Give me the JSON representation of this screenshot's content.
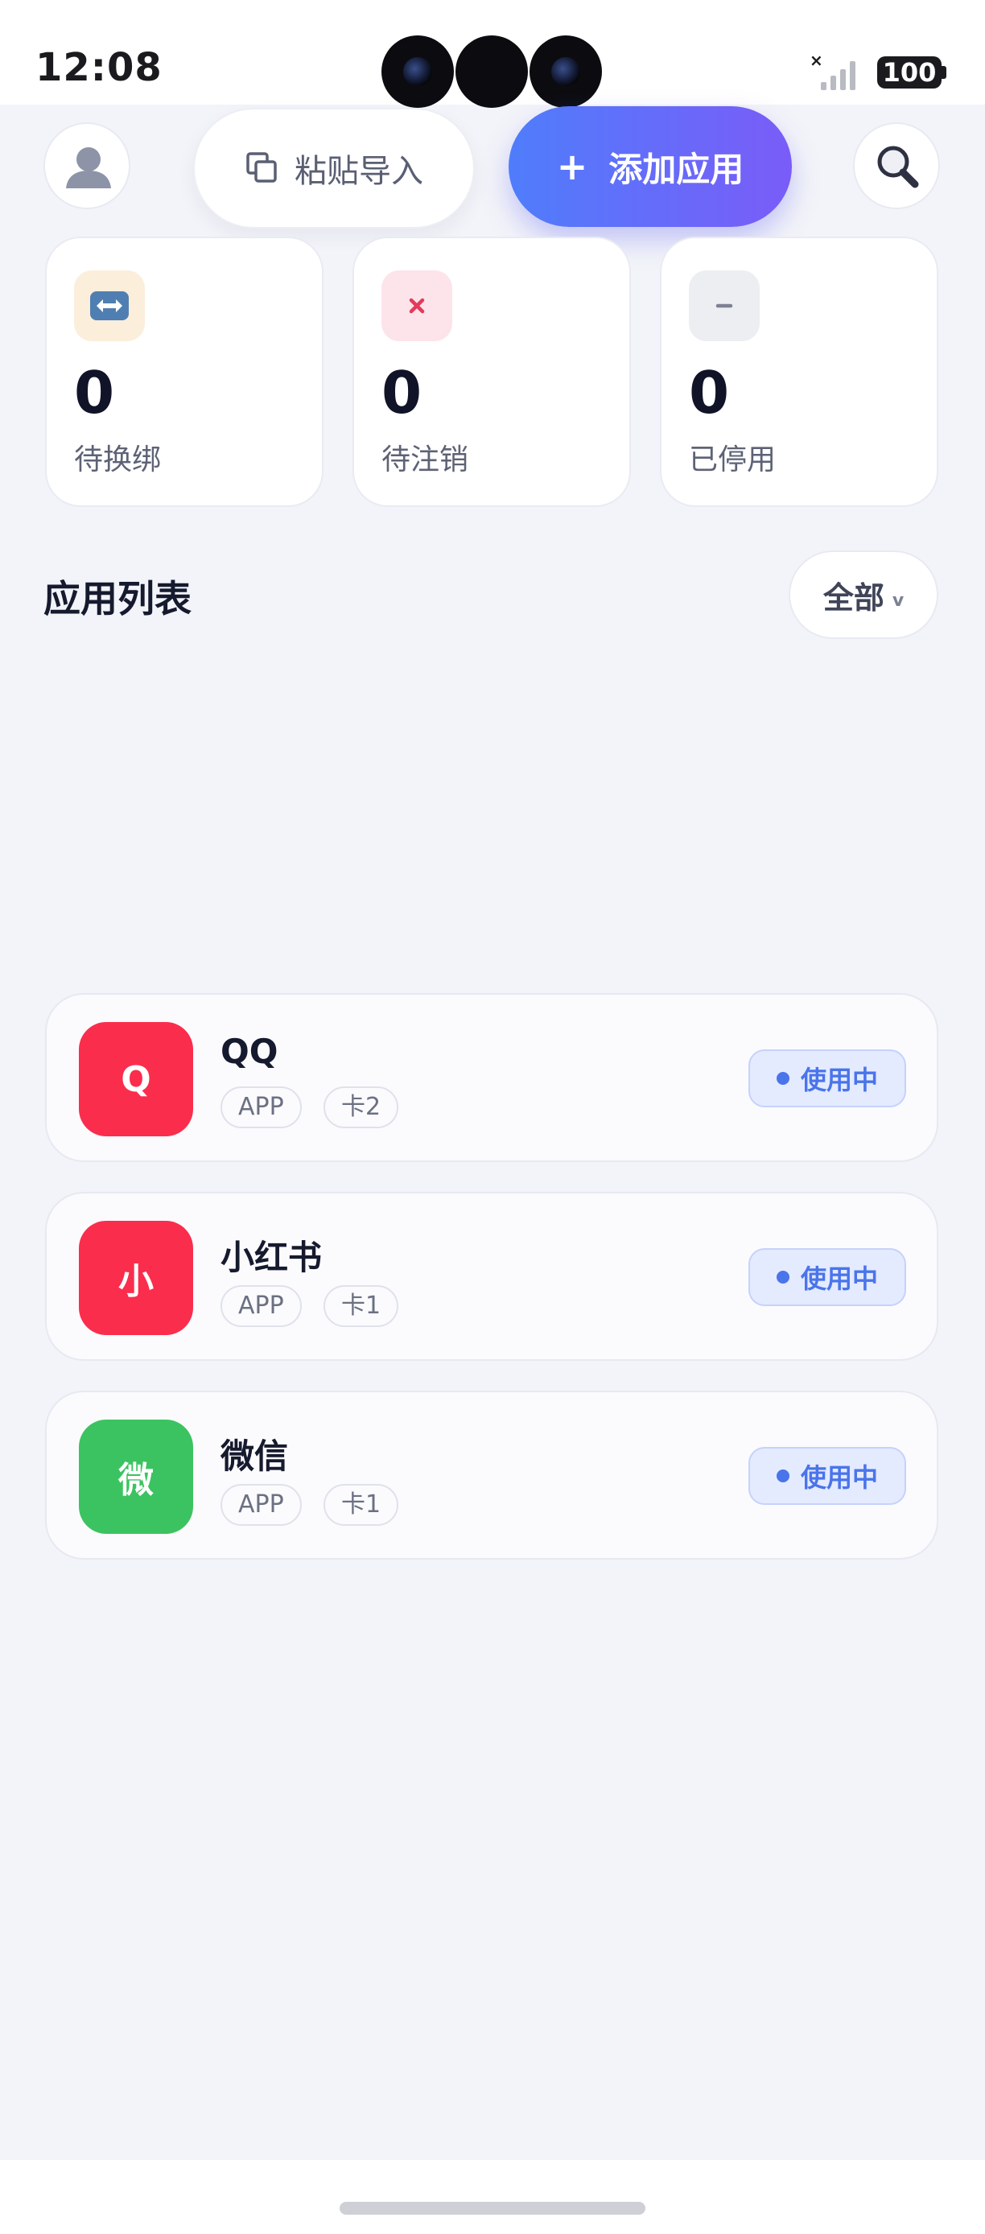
{
  "status_bar": {
    "time": "12:08",
    "battery": "100",
    "signal_icon": "no-signal-icon"
  },
  "header": {
    "avatar_icon": "user-avatar-icon",
    "paste_import_label": "粘贴导入",
    "paste_icon": "copy-icon",
    "add_app_label": "添加应用",
    "add_icon": "plus-icon",
    "search_icon": "search-icon"
  },
  "stats": [
    {
      "value": "0",
      "label": "待换绑",
      "icon": "swap-icon",
      "icon_bg": "#fbeedb",
      "icon_color": "#4f7fb2"
    },
    {
      "value": "0",
      "label": "待注销",
      "icon": "close-icon",
      "icon_bg": "#fde4ea",
      "icon_color": "#e23b5b"
    },
    {
      "value": "0",
      "label": "已停用",
      "icon": "minus-icon",
      "icon_bg": "#eceef2",
      "icon_color": "#7d8190"
    }
  ],
  "section": {
    "title": "应用列表",
    "filter_label": "全部"
  },
  "apps": [
    {
      "icon_text": "Q",
      "name": "QQ",
      "tags": [
        "APP",
        "卡2"
      ],
      "status": "使用中",
      "icon_color": "#fb2d4c"
    },
    {
      "icon_text": "小",
      "name": "小红书",
      "tags": [
        "APP",
        "卡1"
      ],
      "status": "使用中",
      "icon_color": "#fb2d4c"
    },
    {
      "icon_text": "微",
      "name": "微信",
      "tags": [
        "APP",
        "卡1"
      ],
      "status": "使用中",
      "icon_color": "#3cc361"
    }
  ]
}
